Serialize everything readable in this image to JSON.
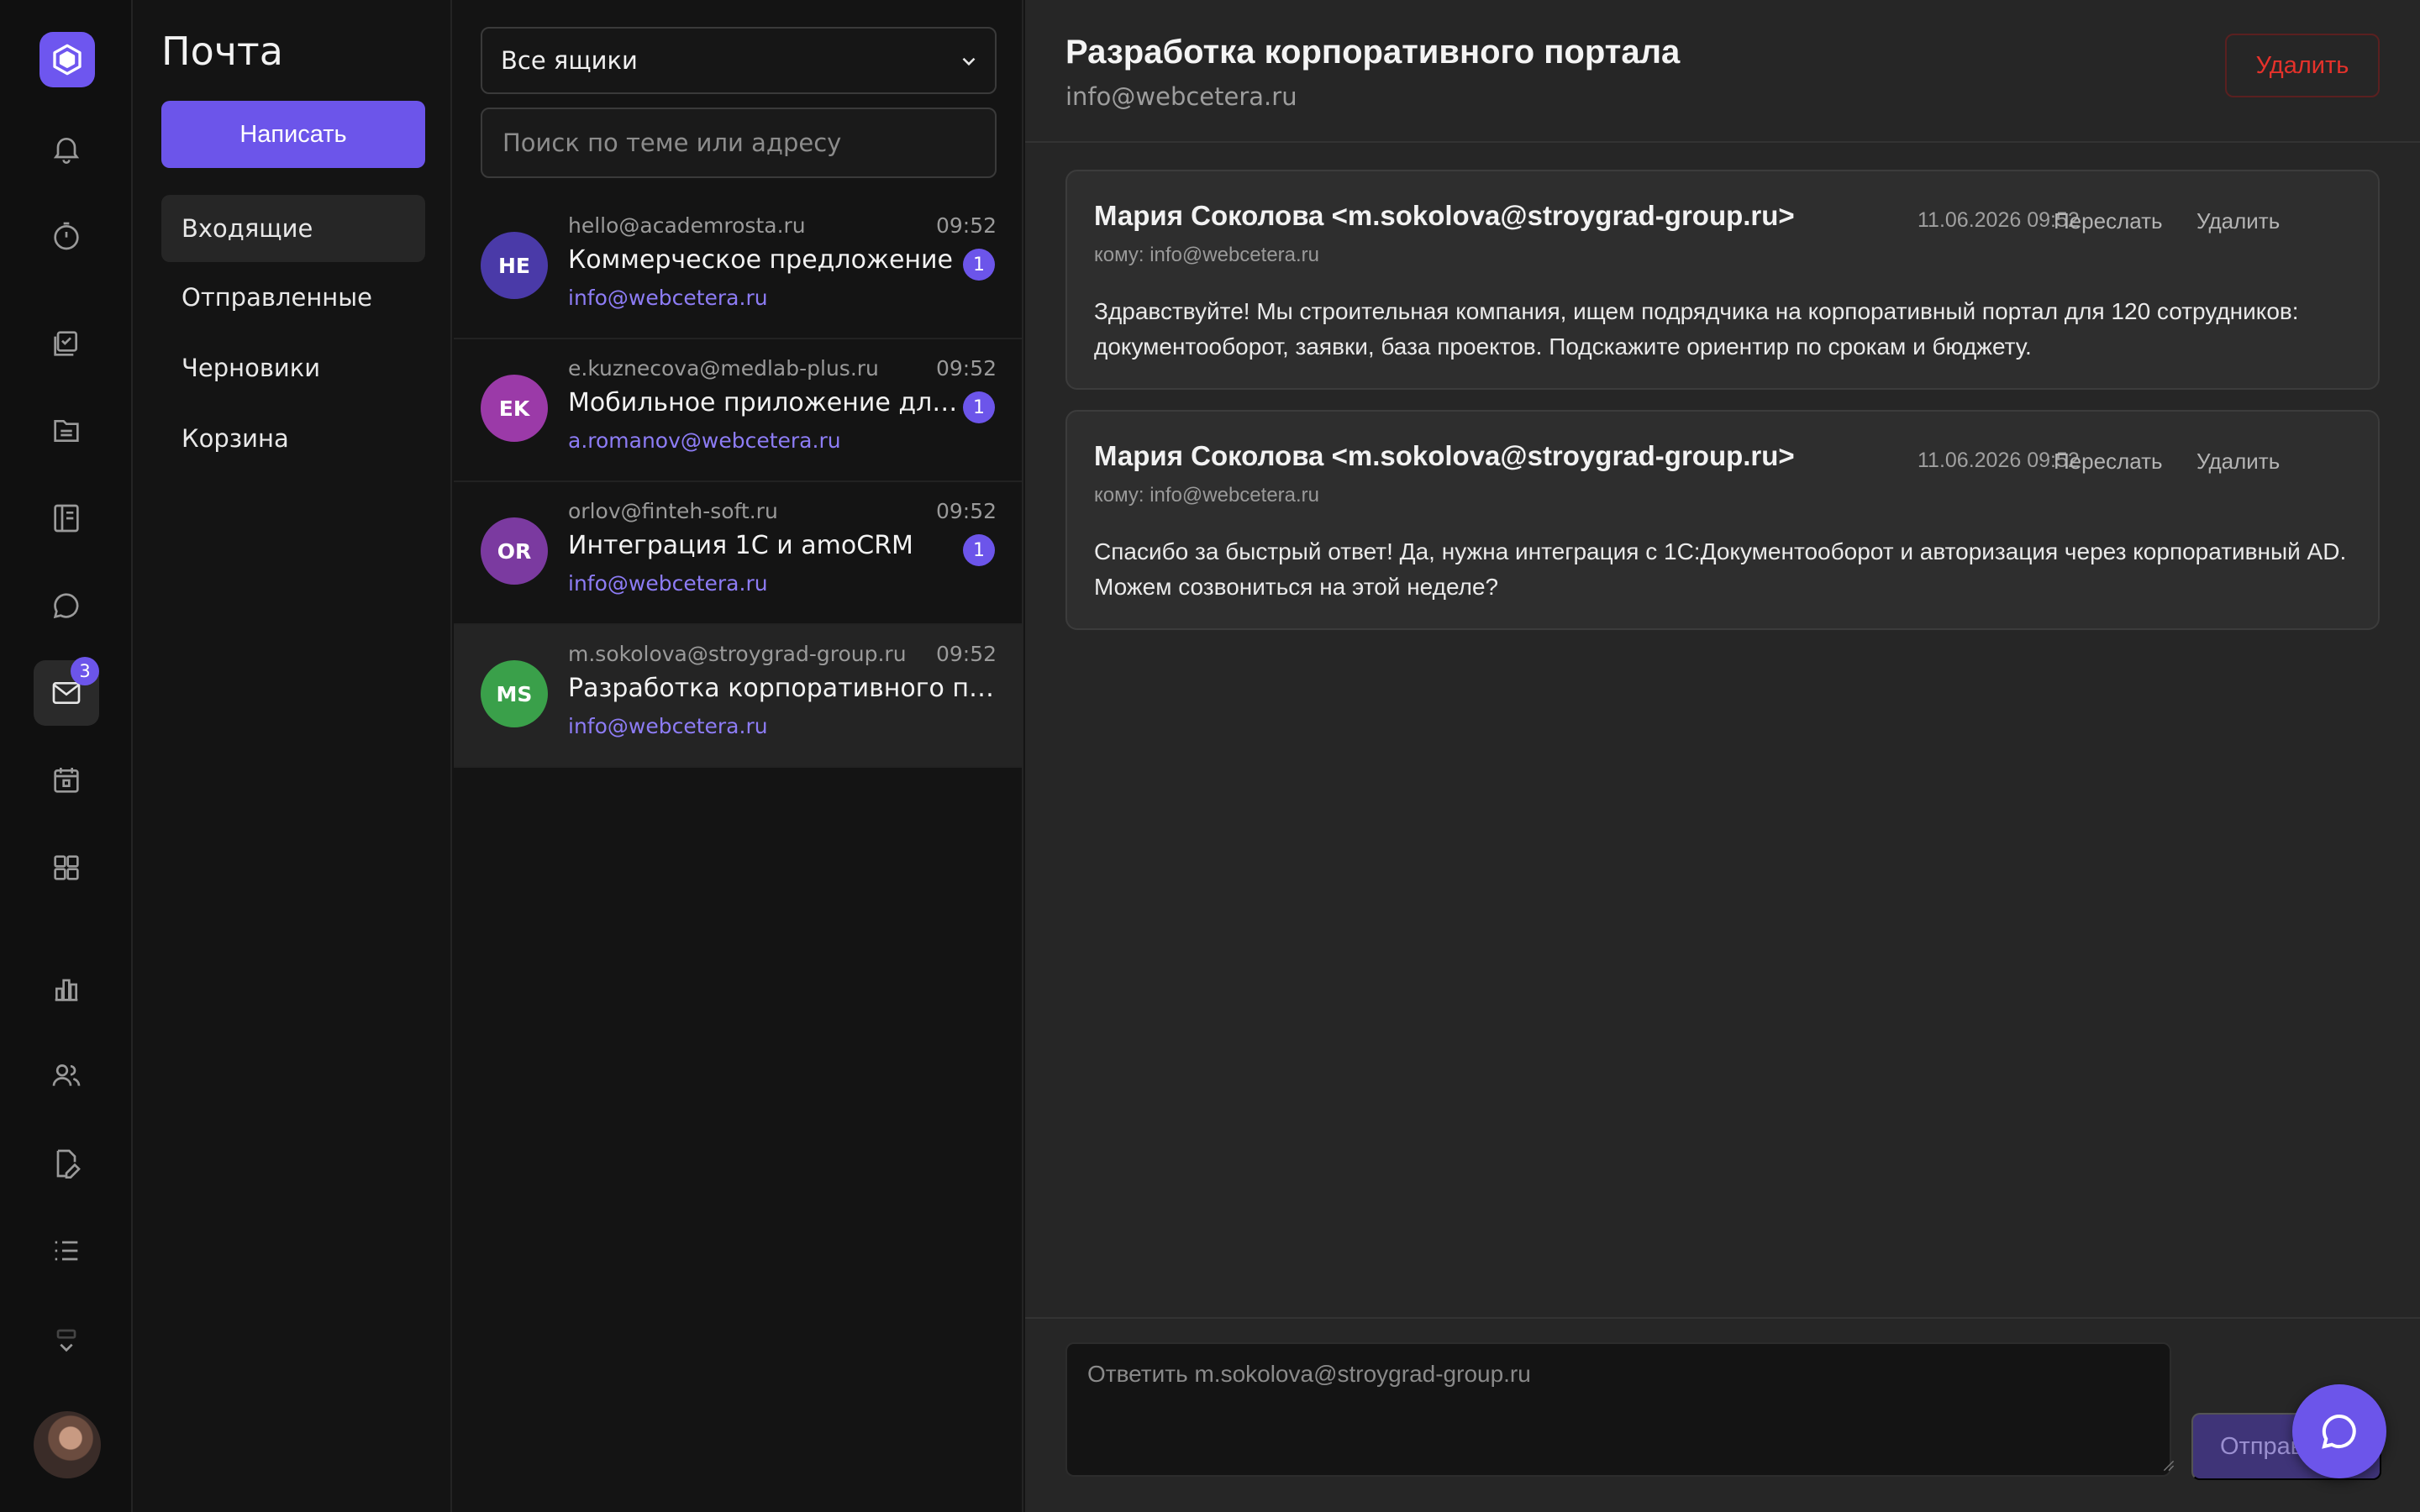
{
  "rail": {
    "logo": "cube-logo-icon",
    "items": [
      {
        "icon": "bell-icon"
      },
      {
        "icon": "stopwatch-icon"
      },
      {
        "icon": "tasks-icon"
      },
      {
        "icon": "folder-icon"
      },
      {
        "icon": "notebook-icon"
      },
      {
        "icon": "chat-bubble-icon"
      },
      {
        "icon": "mail-icon",
        "badge": "3",
        "active": true
      },
      {
        "icon": "calendar-icon"
      },
      {
        "icon": "apps-grid-icon"
      },
      {
        "icon": "bar-chart-icon"
      },
      {
        "icon": "users-icon"
      },
      {
        "icon": "document-edit-icon"
      },
      {
        "icon": "list-icon"
      },
      {
        "icon": "chevron-down-icon"
      }
    ]
  },
  "folders": {
    "title": "Почта",
    "compose_label": "Написать",
    "items": [
      {
        "label": "Входящие",
        "active": true
      },
      {
        "label": "Отправленные"
      },
      {
        "label": "Черновики"
      },
      {
        "label": "Корзина"
      }
    ]
  },
  "list": {
    "mailbox_selected": "Все ящики",
    "search_placeholder": "Поиск по теме или адресу",
    "threads": [
      {
        "initials": "HE",
        "avatar_color": "#4a3aa8",
        "from": "hello@academrosta.ru",
        "time": "09:52",
        "subject": "Коммерческое предложение",
        "count": "1",
        "to": "info@webcetera.ru"
      },
      {
        "initials": "EK",
        "avatar_color": "#9b3aa8",
        "from": "e.kuznecova@medlab-plus.ru",
        "time": "09:52",
        "subject": "Мобильное приложение для клиники",
        "count": "1",
        "to": "a.romanov@webcetera.ru"
      },
      {
        "initials": "OR",
        "avatar_color": "#7b3aa0",
        "from": "orlov@finteh-soft.ru",
        "time": "09:52",
        "subject": "Интеграция 1С и amoCRM",
        "count": "1",
        "to": "info@webcetera.ru"
      },
      {
        "initials": "MS",
        "avatar_color": "#3aa04a",
        "from": "m.sokolova@stroygrad-group.ru",
        "time": "09:52",
        "subject": "Разработка корпоративного портала",
        "count": "",
        "to": "info@webcetera.ru",
        "selected": true
      }
    ]
  },
  "reader": {
    "title": "Разработка корпоративного портала",
    "subtitle": "info@webcetera.ru",
    "delete_label": "Удалить",
    "messages": [
      {
        "sender": "Мария Соколова <m.sokolova@stroygrad-group.ru>",
        "date": "11.06.2026 09:52",
        "forward_label": "Переслать",
        "delete_label": "Удалить",
        "recipient": "кому: info@webcetera.ru",
        "body": "Здравствуйте! Мы строительная компания, ищем подрядчика на корпоративный портал для 120 сотрудников: документооборот, заявки, база проектов. Подскажите ориентир по срокам и бюджету."
      },
      {
        "sender": "Мария Соколова <m.sokolova@stroygrad-group.ru>",
        "date": "11.06.2026 09:52",
        "forward_label": "Переслать",
        "delete_label": "Удалить",
        "recipient": "кому: info@webcetera.ru",
        "body": "Спасибо за быстрый ответ! Да, нужна интеграция с 1С:Документооборот и авторизация через корпоративный AD. Можем созвониться на этой неделе?"
      }
    ],
    "reply_placeholder": "Ответить m.sokolova@stroygrad-group.ru",
    "send_label": "Отправить"
  },
  "colors": {
    "accent": "#6c55ea",
    "danger": "#e5322b",
    "link": "#8d7cf5"
  },
  "fab": {
    "icon": "chat-icon"
  }
}
